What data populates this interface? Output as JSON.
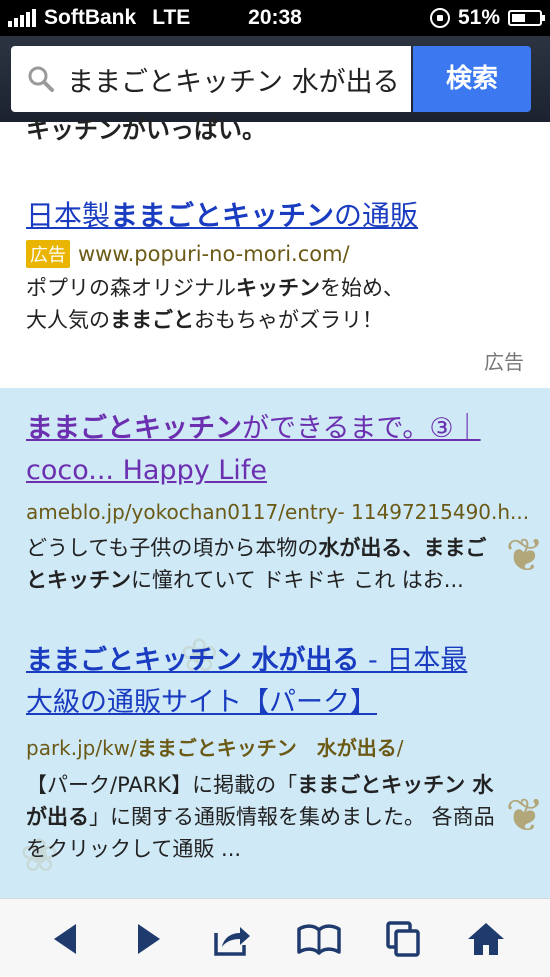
{
  "status": {
    "carrier": "SoftBank",
    "network": "LTE",
    "time": "20:38",
    "battery": "51%",
    "battery_fill": 0.51
  },
  "search": {
    "query": "ままごとキッチン 水が出る",
    "button": "検索"
  },
  "ad": {
    "cut_text": "キッチンがいっぱい。",
    "title_parts": [
      "日本製",
      "ままごとキッチン",
      "の通販"
    ],
    "badge": "広告",
    "url": "www.popuri-no-mori.com/",
    "desc_lines": [
      [
        "ポプリの森オリジナル",
        "キッチン",
        "を始め、"
      ],
      [
        "大人気の",
        "ままごと",
        "おもちゃがズラリ！"
      ]
    ],
    "label": "広告"
  },
  "results": [
    {
      "title_line1": [
        "ままごとキッチン",
        "ができるまで。③｜"
      ],
      "title_line2": "coco... Happy Life",
      "url": "ameblo.jp/yokochan0117/entry- 11497215490.h...",
      "desc_line1": [
        "どうしても子供の頃から本物の",
        "水が出る、まま",
        "ご"
      ],
      "desc_line2": [
        "とキッチン",
        "に憧れていて ドキドキ これ はお..."
      ]
    },
    {
      "title_line1": [
        "ままごとキッチン 水が出る",
        " - 日本最"
      ],
      "title_line2": "大級の通販サイト【パーク】",
      "url": [
        "park.jp/kw/",
        "ままごとキッチン　水が出る",
        "/"
      ],
      "desc_line1": [
        "【パーク/PARK】に掲載の「",
        "ままごとキッチン 水"
      ],
      "desc_line2": [
        "が出る",
        "」に関する通販情報を集めました。 各商品"
      ],
      "desc_line3": "をクリックして通販 ..."
    }
  ],
  "colors": {
    "link": "#1a3cc0",
    "visited": "#6b2fb0",
    "button": "#3c79f0",
    "results_bg": "#cfe9f7"
  },
  "toolbar": [
    "back-icon",
    "forward-icon",
    "share-icon",
    "bookmarks-icon",
    "tabs-icon",
    "home-icon"
  ]
}
